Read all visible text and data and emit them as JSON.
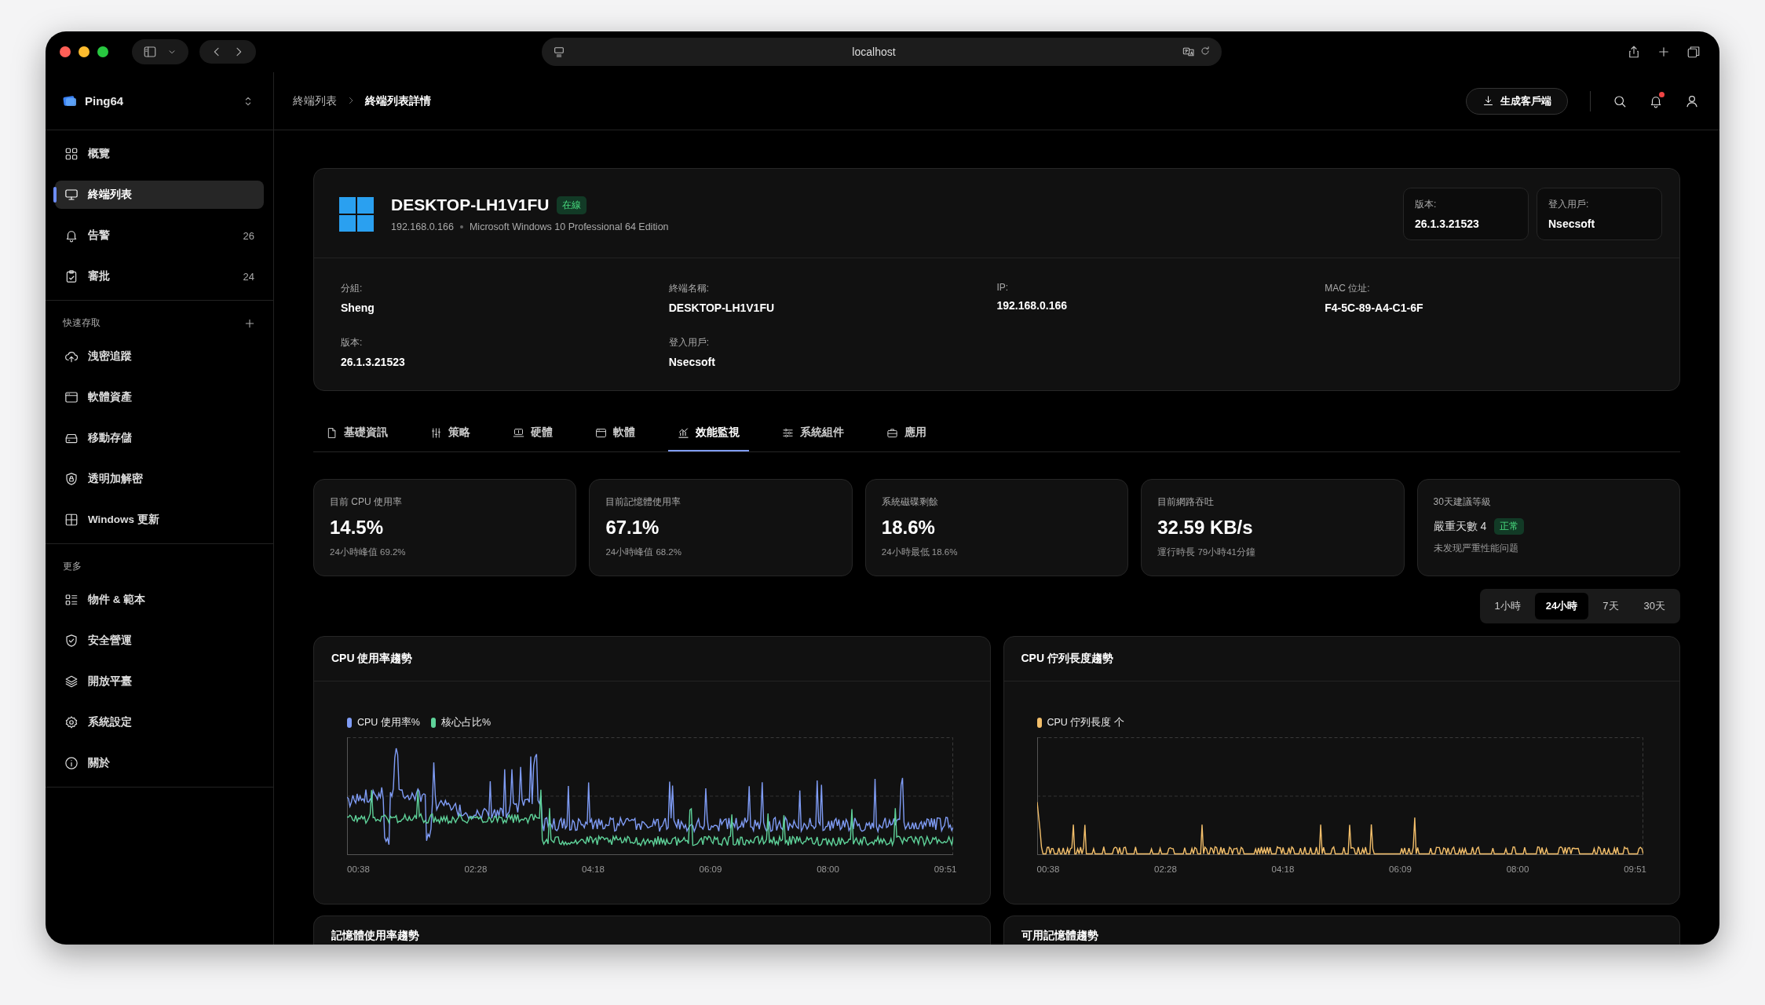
{
  "browser": {
    "address": "localhost"
  },
  "sidebar": {
    "brand": "Ping64",
    "main": [
      {
        "label": "概覽",
        "selected": false
      },
      {
        "label": "終端列表",
        "selected": true
      },
      {
        "label": "告警",
        "count": "26",
        "selected": false
      },
      {
        "label": "審批",
        "count": "24",
        "selected": false
      }
    ],
    "quick_access": {
      "title": "快速存取",
      "items": [
        {
          "label": "洩密追蹤",
          "selected": false
        },
        {
          "label": "軟體資產",
          "selected": false
        },
        {
          "label": "移動存儲",
          "selected": false
        },
        {
          "label": "透明加解密",
          "selected": false
        },
        {
          "label": "Windows 更新",
          "selected": false
        }
      ]
    },
    "more": {
      "title": "更多",
      "items": [
        {
          "label": "物件 & 範本",
          "selected": false
        },
        {
          "label": "安全營運",
          "selected": false
        },
        {
          "label": "開放平臺",
          "selected": false
        },
        {
          "label": "系統設定",
          "selected": false
        },
        {
          "label": "關於",
          "selected": false
        }
      ]
    }
  },
  "header": {
    "breadcrumb": [
      "終端列表",
      "終端列表詳情"
    ],
    "action": "生成客戶端",
    "unread": true
  },
  "device": {
    "name": "DESKTOP-LH1V1FU",
    "status": "在線",
    "ip": "192.168.0.166",
    "os": "Microsoft Windows 10 Professional 64 Edition",
    "summary": [
      {
        "label": "版本:",
        "value": "26.1.3.21523"
      },
      {
        "label": "登入用戶:",
        "value": "Nsecsoft"
      }
    ],
    "fields": [
      {
        "label": "分組:",
        "value": "Sheng"
      },
      {
        "label": "終端名稱:",
        "value": "DESKTOP-LH1V1FU"
      },
      {
        "label": "IP:",
        "value": "192.168.0.166"
      },
      {
        "label": "MAC 位址:",
        "value": "F4-5C-89-A4-C1-6F"
      },
      {
        "label": "版本:",
        "value": "26.1.3.21523"
      },
      {
        "label": "登入用戶:",
        "value": "Nsecsoft"
      }
    ]
  },
  "tabs": [
    {
      "label": "基礎資訊",
      "selected": false
    },
    {
      "label": "策略",
      "selected": false
    },
    {
      "label": "硬體",
      "selected": false
    },
    {
      "label": "軟體",
      "selected": false
    },
    {
      "label": "效能監視",
      "selected": true
    },
    {
      "label": "系統組件",
      "selected": false
    },
    {
      "label": "應用",
      "selected": false
    }
  ],
  "stats": [
    {
      "kind": "metric",
      "label": "目前 CPU 使用率",
      "value": "14.5%",
      "note": "24小時峰值 69.2%"
    },
    {
      "kind": "metric",
      "label": "目前記憶體使用率",
      "value": "67.1%",
      "note": "24小時峰值 68.2%"
    },
    {
      "kind": "metric",
      "label": "系統磁碟剩餘",
      "value": "18.6%",
      "note": "24小時最低 18.6%"
    },
    {
      "kind": "metric",
      "label": "目前網路吞吐",
      "value": "32.59 KB/s",
      "note": "運行時長 79小時41分鐘"
    },
    {
      "kind": "level",
      "label": "30天建議等級",
      "value": "嚴重天數 4",
      "badge": "正常",
      "note": "未发现严重性能问题"
    }
  ],
  "ranges": [
    {
      "label": "1小時",
      "selected": false
    },
    {
      "label": "24小時",
      "selected": true
    },
    {
      "label": "7天",
      "selected": false
    },
    {
      "label": "30天",
      "selected": false
    }
  ],
  "charts": [
    {
      "title": "CPU 使用率趨勢",
      "legend": [
        {
          "name": "CPU 使用率%",
          "color": "#7f9cf5"
        },
        {
          "name": "核心占比%",
          "color": "#5fd39a"
        }
      ],
      "x_labels": [
        "00:38",
        "02:28",
        "04:18",
        "06:09",
        "08:00",
        "09:51"
      ]
    },
    {
      "title": "CPU 佇列長度趨勢",
      "legend": [
        {
          "name": "CPU 佇列長度 个",
          "color": "#f2be6a"
        }
      ],
      "x_labels": [
        "00:38",
        "02:28",
        "04:18",
        "06:09",
        "08:00",
        "09:51"
      ]
    }
  ],
  "more_charts": [
    {
      "title": "記憶體使用率趨勢"
    },
    {
      "title": "可用記憶體趨勢"
    }
  ]
}
